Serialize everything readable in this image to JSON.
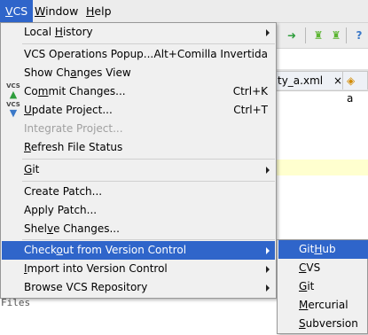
{
  "menubar": {
    "items": [
      {
        "pre": "",
        "ul": "V",
        "post": "CS"
      },
      {
        "pre": "",
        "ul": "W",
        "post": "indow"
      },
      {
        "pre": "",
        "ul": "H",
        "post": "elp"
      }
    ]
  },
  "background": {
    "tabs": [
      "ty_a.xml",
      "a"
    ],
    "tab_close": "×",
    "files_text": "Files",
    "toolbar_icons": {
      "android_run": "green-android-icon",
      "help": "?"
    }
  },
  "vcs_menu": {
    "items": [
      {
        "pre": "Local ",
        "ul": "H",
        "post": "istory",
        "shortcut": "",
        "submenu": true
      },
      {
        "pre": "VCS Operations Popup...",
        "ul": "",
        "post": "",
        "shortcut": "Alt+Comilla Invertida",
        "submenu": false
      },
      {
        "pre": "Show Ch",
        "ul": "a",
        "post": "nges View",
        "shortcut": "",
        "submenu": false
      },
      {
        "pre": "Co",
        "ul": "m",
        "post": "mit Changes...",
        "shortcut": "Ctrl+K",
        "submenu": false,
        "icon": {
          "label": "VCS",
          "arrow": "▲",
          "color": "#2e9d3c"
        }
      },
      {
        "pre": "",
        "ul": "U",
        "post": "pdate Project...",
        "shortcut": "Ctrl+T",
        "submenu": false,
        "icon": {
          "label": "VCS",
          "arrow": "▼",
          "color": "#3a78c8"
        }
      },
      {
        "pre": "Integrate Project...",
        "ul": "",
        "post": "",
        "shortcut": "",
        "submenu": false,
        "disabled": true
      },
      {
        "pre": "",
        "ul": "R",
        "post": "efresh File Status",
        "shortcut": "",
        "submenu": false
      },
      {
        "pre": "",
        "ul": "G",
        "post": "it",
        "shortcut": "",
        "submenu": true
      },
      {
        "pre": "Create Patch...",
        "ul": "",
        "post": "",
        "shortcut": "",
        "submenu": false
      },
      {
        "pre": "Apply Patch...",
        "ul": "",
        "post": "",
        "shortcut": "",
        "submenu": false
      },
      {
        "pre": "Shel",
        "ul": "v",
        "post": "e Changes...",
        "shortcut": "",
        "submenu": false
      },
      {
        "pre": "Check",
        "ul": "o",
        "post": "ut from Version Control",
        "shortcut": "",
        "submenu": true,
        "highlighted": true
      },
      {
        "pre": "",
        "ul": "I",
        "post": "mport into Version Control",
        "shortcut": "",
        "submenu": true
      },
      {
        "pre": "Browse VCS Repository",
        "ul": "",
        "post": "",
        "shortcut": "",
        "submenu": true
      }
    ]
  },
  "checkout_submenu": {
    "items": [
      {
        "pre": "Git",
        "ul": "H",
        "post": "ub",
        "highlighted": true
      },
      {
        "pre": "",
        "ul": "C",
        "post": "VS"
      },
      {
        "pre": "",
        "ul": "G",
        "post": "it"
      },
      {
        "pre": "",
        "ul": "M",
        "post": "ercurial"
      },
      {
        "pre": "",
        "ul": "S",
        "post": "ubversion"
      }
    ]
  },
  "colors": {
    "highlight": "#2f65ca",
    "menu_bg": "#f0f0f0",
    "disabled_text": "#a0a0a0"
  }
}
